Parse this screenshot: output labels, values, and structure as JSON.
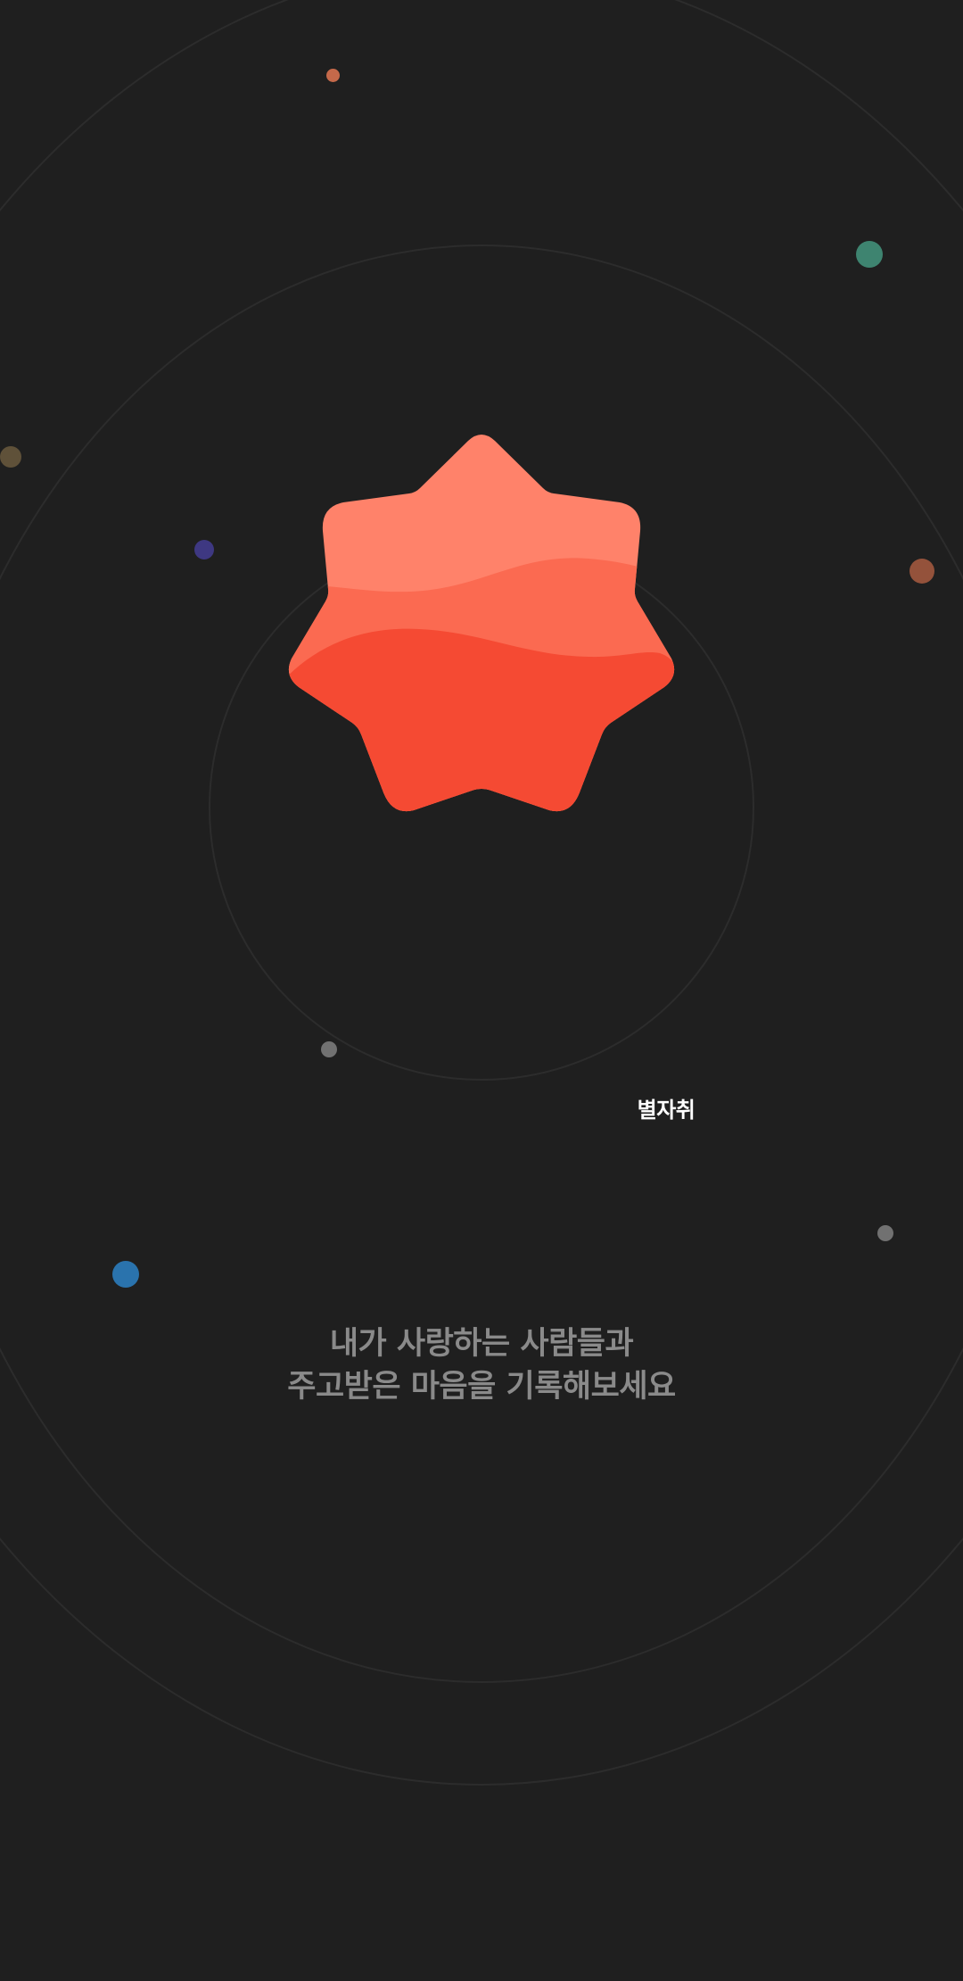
{
  "app": {
    "name": "별자취",
    "tagline_line1": "내가 사랑하는 사람들과",
    "tagline_line2": "주고받은 마음을 기록해보세요"
  },
  "logo": {
    "icon": "seven-point-star-icon",
    "colors": {
      "top": "#ff826a",
      "middle": "#fb6a51",
      "bottom": "#f54a33"
    }
  },
  "decor": {
    "orbit_color": "#2c2c2c",
    "dot_colors": {
      "orange": "#c5694a",
      "teal": "#3e8470",
      "olive": "#5f5139",
      "purple": "#3e3882",
      "rust": "#94523b",
      "gray": "#717171",
      "blue": "#2a73ad"
    }
  }
}
